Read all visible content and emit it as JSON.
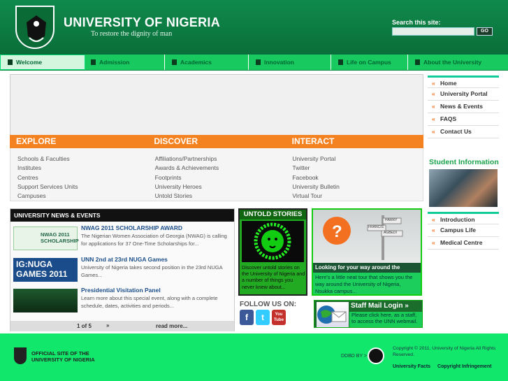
{
  "header": {
    "title": "UNIVERSITY OF NIGERIA",
    "motto": "To restore the dignity of man",
    "search_label": "Search this site:",
    "search_button": "GO"
  },
  "nav": [
    {
      "label": "Welcome",
      "icon": "book-icon",
      "active": true
    },
    {
      "label": "Admission",
      "icon": "document-icon"
    },
    {
      "label": "Academics",
      "icon": "graduation-cap-icon"
    },
    {
      "label": "Innovation",
      "icon": "lightbulb-icon"
    },
    {
      "label": "Life on Campus",
      "icon": "people-icon"
    },
    {
      "label": "About the University",
      "icon": "crest-icon"
    }
  ],
  "edi": {
    "headings": [
      "EXPLORE",
      "DISCOVER",
      "INTERACT"
    ],
    "explore": [
      "Schools & Faculties",
      "Institutes",
      "Centres",
      "Support Services Units",
      "Campuses"
    ],
    "discover": [
      "Affiliations/Partnerships",
      "Awards & Achievements",
      "Footprints",
      "University Heroes",
      "Untold Stories"
    ],
    "interact": [
      "University Portal",
      "Twitter",
      "Facebook",
      "University Bulletin",
      "Virtual Tour"
    ]
  },
  "right_nav": [
    "Home",
    "University Portal",
    "News & Events",
    "FAQS",
    "Contact Us"
  ],
  "student_info": {
    "heading": "Student Information",
    "links": [
      "Introduction",
      "Campus Life",
      "Medical Centre"
    ]
  },
  "news": {
    "heading": "UNIVERSITY NEWS & EVENTS",
    "items": [
      {
        "title": "NWAG 2011 SCHOLARSHIP AWARD",
        "text": "The Nigerian Women Association of Georgia (NWAG) is calling for applications for 37 One-Time Scholarships for...",
        "thumb": "NWAG 2011 SCHOLARSHIP"
      },
      {
        "title": "UNN 2nd at 23rd NUGA Games",
        "text": "University of Nigeria takes second position in the 23rd NUGA Games...",
        "thumb": "IG:NUGA GAMES 2011"
      },
      {
        "title": "Presidential Visitation Panel",
        "text": "Learn more about this special event, along with a complete schedule, dates, activities and periods...",
        "thumb": ""
      }
    ],
    "pager": "1 of 5",
    "next": "»",
    "read_more": "read more..."
  },
  "untold": {
    "heading": "UNTOLD STORIES",
    "text": "Discover untold stories on the University of Nigeria and a number of things you never knew about..."
  },
  "tour": {
    "heading": "Looking for your way around the campus?",
    "text": "Here's a little neat tour that shows you the way around the University of Nigeria, Nsukka campus...",
    "signs": [
      "FRANCIS",
      "AGBEDI",
      "HARRY"
    ]
  },
  "follow": {
    "heading": "FOLLOW US ON:",
    "networks": [
      "f",
      "t",
      "You Tube"
    ]
  },
  "staff_mail": {
    "heading": "Staff Mail Login »",
    "text": "Please click here, as a staff, to access the UNN webmail."
  },
  "footer": {
    "official": "OFFICIAL SITE OF THE UNIVERSITY OF NIGERIA",
    "ddbd": "DDBD BY >",
    "copyright": "Copyright © 2011. University of Nigeria All Rights Reserved.",
    "links": [
      "University Facts",
      "Copyright Infringement"
    ]
  },
  "colors": {
    "brand_green": "#0f8a4c",
    "nav_green": "#18c95f",
    "accent_orange": "#f58220",
    "footer_green": "#11e86b"
  }
}
